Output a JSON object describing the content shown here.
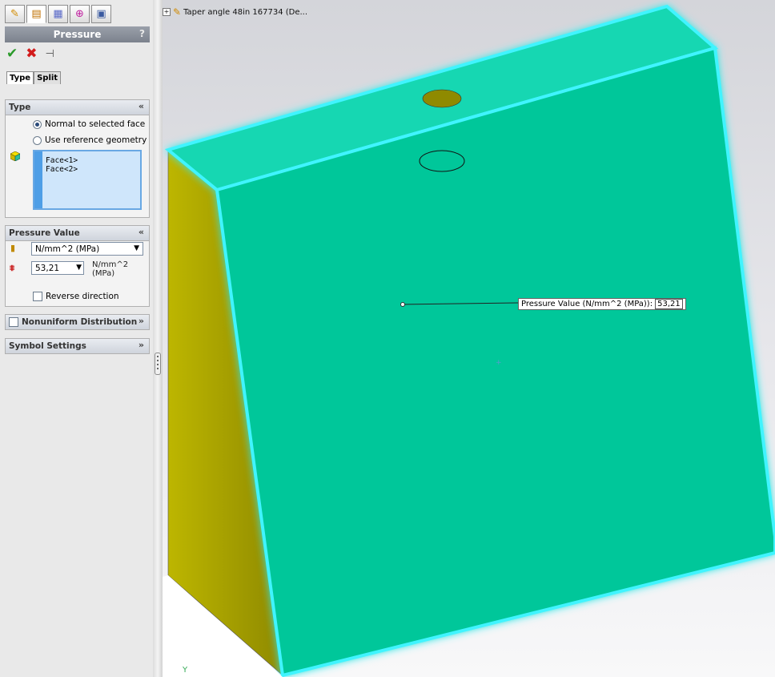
{
  "panel": {
    "title": "Pressure",
    "help": "?",
    "tabs": [
      "Type",
      "Split"
    ],
    "type_group": {
      "header": "Type",
      "options": [
        "Normal to selected face",
        "Use reference geometry"
      ],
      "selected_option": 0,
      "faces": [
        "Face<1>",
        "Face<2>"
      ]
    },
    "pressure_group": {
      "header": "Pressure Value",
      "unit_select": "N/mm^2 (MPa)",
      "value": "53,21",
      "unit_label_line1": "N/mm^2",
      "unit_label_line2": "(MPa)",
      "reverse_label": "Reverse direction"
    },
    "nonuniform_label": "Nonuniform Distribution",
    "symbol_settings_label": "Symbol Settings"
  },
  "viewport": {
    "tree_label": "Taper angle 48in 167734  (De...",
    "callout_label": "Pressure Value (N/mm^2 (MPa)):",
    "callout_value": "53,21",
    "triad_y": "Y"
  },
  "colors": {
    "front_face": "#00c79a",
    "top_face": "#12d8b0",
    "side_face": "#b9b300",
    "glow": "#3cf4ff"
  }
}
